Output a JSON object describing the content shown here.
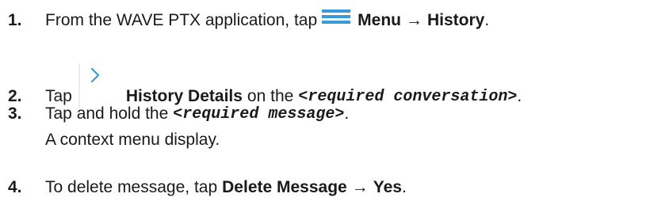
{
  "steps": [
    {
      "number": "1.",
      "text_before": "From the WAVE PTX application, tap",
      "icon": "hamburger-menu-icon",
      "bold1": "Menu",
      "arrow": "→",
      "bold2": "History",
      "text_after": "."
    },
    {
      "number": "2.",
      "text_before": "Tap",
      "icon": "chevron-right-icon",
      "bold1": "History Details",
      "text_middle": "on the",
      "code": "<required conversation>",
      "text_after": "."
    },
    {
      "number": "3.",
      "text_before": "Tap and hold the",
      "code": "<required message>",
      "text_after": ".",
      "note": "A context menu display."
    },
    {
      "number": "4.",
      "text_before": "To delete message, tap",
      "bold1": "Delete Message",
      "arrow": "→",
      "bold2": "Yes",
      "text_after": "."
    }
  ],
  "colors": {
    "icon_blue": "#3b9ad9",
    "text": "#1a1a1a"
  }
}
